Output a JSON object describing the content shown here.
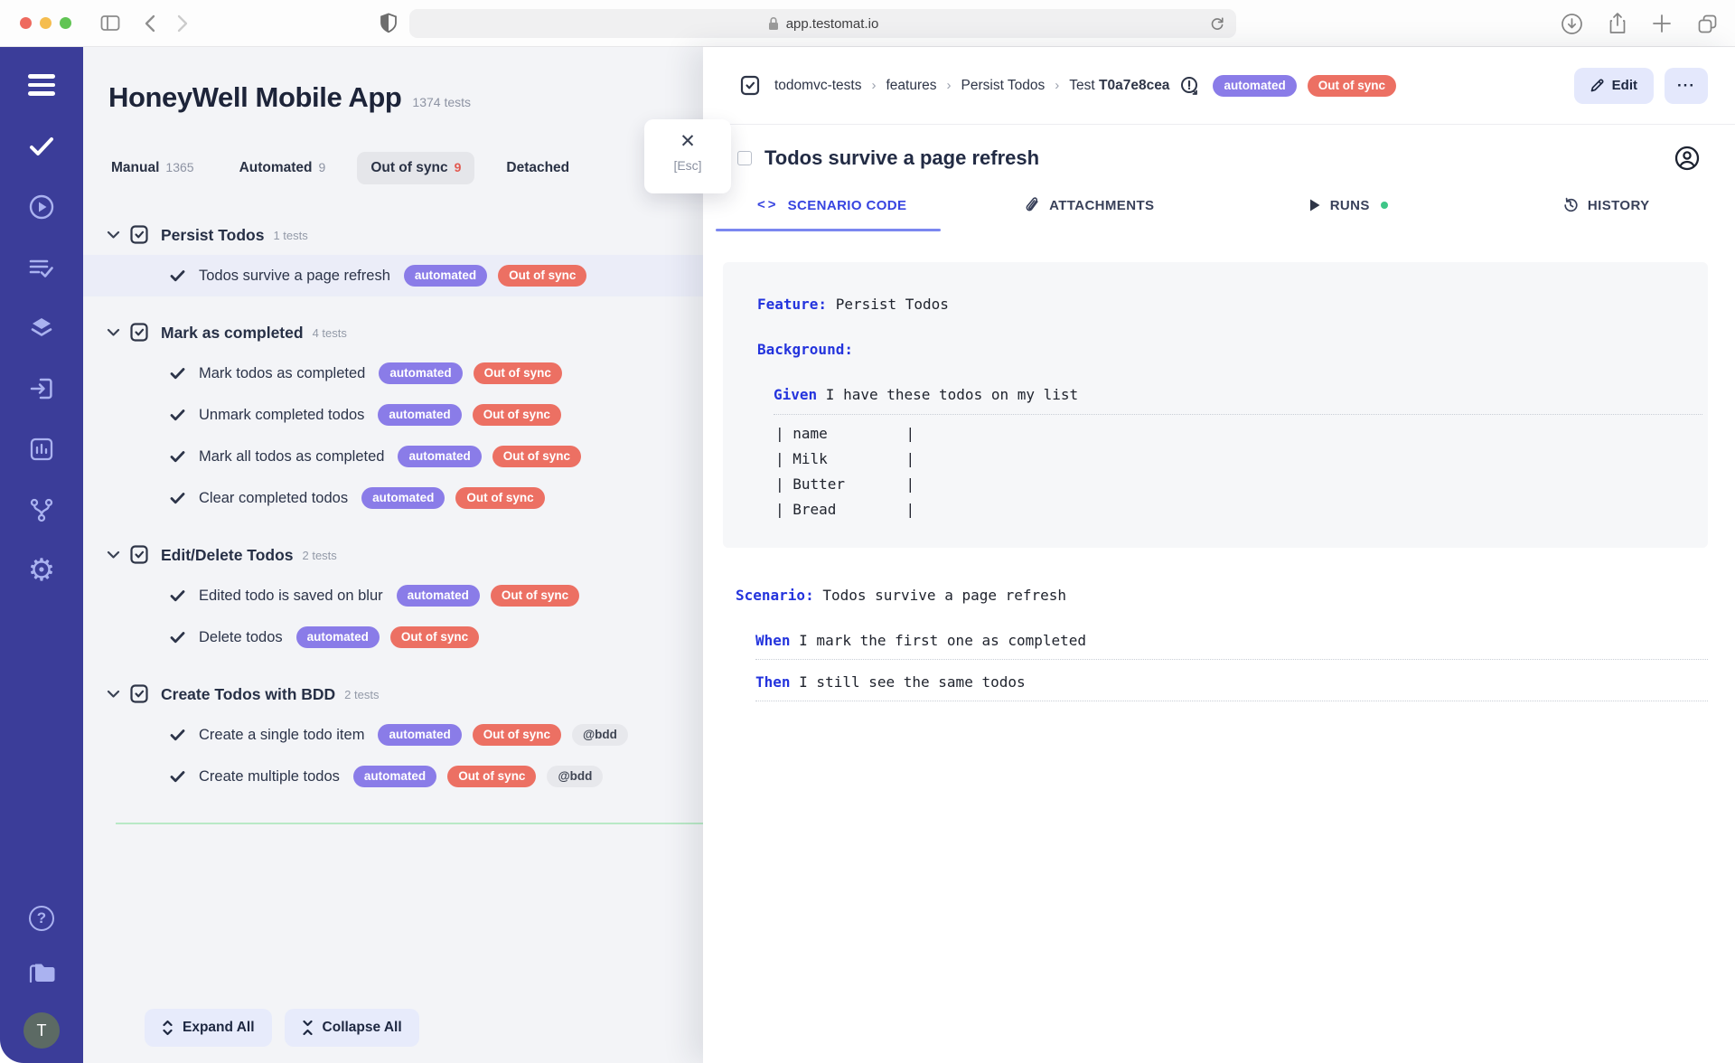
{
  "browser": {
    "url": "app.testomat.io"
  },
  "app": {
    "sidebar_avatar": "T"
  },
  "left_panel": {
    "title": "HoneyWell Mobile App",
    "subtitle": "1374 tests",
    "tabs": [
      {
        "label": "Manual",
        "count": "1365",
        "active": false
      },
      {
        "label": "Automated",
        "count": "9",
        "active": false
      },
      {
        "label": "Out of sync",
        "count": "9",
        "active": true
      },
      {
        "label": "Detached",
        "count": "",
        "active": false
      }
    ],
    "suites": [
      {
        "name": "Persist Todos",
        "count": "1 tests",
        "tests": [
          {
            "name": "Todos survive a page refresh",
            "badges": [
              "automated",
              "Out of sync"
            ],
            "tags": [],
            "selected": true
          }
        ]
      },
      {
        "name": "Mark as completed",
        "count": "4 tests",
        "tests": [
          {
            "name": "Mark todos as completed",
            "badges": [
              "automated",
              "Out of sync"
            ],
            "tags": []
          },
          {
            "name": "Unmark completed todos",
            "badges": [
              "automated",
              "Out of sync"
            ],
            "tags": []
          },
          {
            "name": "Mark all todos as completed",
            "badges": [
              "automated",
              "Out of sync"
            ],
            "tags": []
          },
          {
            "name": "Clear completed todos",
            "badges": [
              "automated",
              "Out of sync"
            ],
            "tags": []
          }
        ]
      },
      {
        "name": "Edit/Delete Todos",
        "count": "2 tests",
        "tests": [
          {
            "name": "Edited todo is saved on blur",
            "badges": [
              "automated",
              "Out of sync"
            ],
            "tags": []
          },
          {
            "name": "Delete todos",
            "badges": [
              "automated",
              "Out of sync"
            ],
            "tags": []
          }
        ]
      },
      {
        "name": "Create Todos with BDD",
        "count": "2 tests",
        "tests": [
          {
            "name": "Create a single todo item",
            "badges": [
              "automated",
              "Out of sync"
            ],
            "tags": [
              "@bdd"
            ]
          },
          {
            "name": "Create multiple todos",
            "badges": [
              "automated",
              "Out of sync"
            ],
            "tags": [
              "@bdd"
            ]
          }
        ]
      }
    ],
    "expand_all": "Expand All",
    "collapse_all": "Collapse All"
  },
  "overlay": {
    "esc_hint": "[Esc]",
    "close_glyph": "✕"
  },
  "detail": {
    "breadcrumb": {
      "items": [
        "todomvc-tests",
        "features",
        "Persist Todos"
      ],
      "test_prefix": "Test ",
      "test_id": "T0a7e8cea"
    },
    "badges": [
      {
        "label": "automated",
        "type": "automated"
      },
      {
        "label": "Out of sync",
        "type": "outofsync"
      }
    ],
    "edit_label": "Edit",
    "more_label": "···",
    "title": "Todos survive a page refresh",
    "tabs": [
      {
        "label": "SCENARIO CODE",
        "icon": "code",
        "active": true
      },
      {
        "label": "ATTACHMENTS",
        "icon": "paperclip",
        "active": false
      },
      {
        "label": "RUNS",
        "icon": "play",
        "active": false,
        "dot": true
      },
      {
        "label": "HISTORY",
        "icon": "history",
        "active": false
      }
    ],
    "gherkin": {
      "background": {
        "lines": [
          {
            "keyword": "Feature:",
            "text": " Persist Todos"
          },
          {
            "keyword": "Background:",
            "text": ""
          },
          {
            "keyword": "Given",
            "text": " I have these todos on my list",
            "indent": 1,
            "dotted": true
          },
          {
            "text": "| name         |",
            "mono_row": true
          },
          {
            "text": "| Milk         |",
            "mono_row": true
          },
          {
            "text": "| Butter       |",
            "mono_row": true
          },
          {
            "text": "| Bread        |",
            "mono_row": true
          }
        ]
      },
      "scenario": {
        "lines": [
          {
            "keyword": "Scenario:",
            "text": " Todos survive a page refresh"
          },
          {
            "keyword": "When",
            "text": " I mark the first one as completed",
            "indent": 1,
            "dotted": true
          },
          {
            "keyword": "Then",
            "text": " I still see the same todos",
            "indent": 1,
            "dotted": true
          }
        ]
      }
    }
  }
}
